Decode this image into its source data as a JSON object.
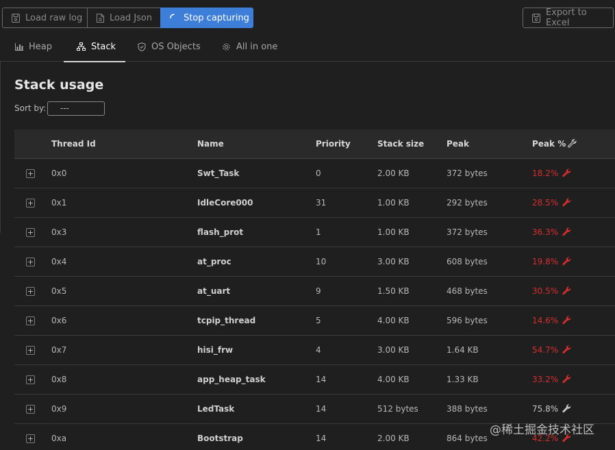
{
  "toolbar": {
    "load_raw_log": "Load raw log",
    "load_json": "Load Json",
    "stop_capturing": "Stop capturing",
    "export_excel": "Export to Excel"
  },
  "tabs": [
    {
      "label": "Heap",
      "icon": "chart-icon"
    },
    {
      "label": "Stack",
      "icon": "hierarchy-icon",
      "active": true
    },
    {
      "label": "OS Objects",
      "icon": "shield-icon"
    },
    {
      "label": "All in one",
      "icon": "gear-icon"
    }
  ],
  "page": {
    "title": "Stack usage",
    "sort_label": "Sort by:",
    "sort_value": "---"
  },
  "table": {
    "columns": [
      "Thread Id",
      "Name",
      "Priority",
      "Stack size",
      "Peak",
      "Peak %"
    ],
    "rows": [
      {
        "id": "0x0",
        "name": "Swt_Task",
        "priority": "0",
        "size": "2.00 KB",
        "peak": "372 bytes",
        "pct": "18.2%",
        "alert": true
      },
      {
        "id": "0x1",
        "name": "IdleCore000",
        "priority": "31",
        "size": "1.00 KB",
        "peak": "292 bytes",
        "pct": "28.5%",
        "alert": true
      },
      {
        "id": "0x3",
        "name": "flash_prot",
        "priority": "1",
        "size": "1.00 KB",
        "peak": "372 bytes",
        "pct": "36.3%",
        "alert": true
      },
      {
        "id": "0x4",
        "name": "at_proc",
        "priority": "10",
        "size": "3.00 KB",
        "peak": "608 bytes",
        "pct": "19.8%",
        "alert": true
      },
      {
        "id": "0x5",
        "name": "at_uart",
        "priority": "9",
        "size": "1.50 KB",
        "peak": "468 bytes",
        "pct": "30.5%",
        "alert": true
      },
      {
        "id": "0x6",
        "name": "tcpip_thread",
        "priority": "5",
        "size": "4.00 KB",
        "peak": "596 bytes",
        "pct": "14.6%",
        "alert": true
      },
      {
        "id": "0x7",
        "name": "hisi_frw",
        "priority": "4",
        "size": "3.00 KB",
        "peak": "1.64 KB",
        "pct": "54.7%",
        "alert": true
      },
      {
        "id": "0x8",
        "name": "app_heap_task",
        "priority": "14",
        "size": "4.00 KB",
        "peak": "1.33 KB",
        "pct": "33.2%",
        "alert": true
      },
      {
        "id": "0x9",
        "name": "LedTask",
        "priority": "14",
        "size": "512 bytes",
        "peak": "388 bytes",
        "pct": "75.8%",
        "alert": false
      },
      {
        "id": "0xa",
        "name": "Bootstrap",
        "priority": "14",
        "size": "2.00 KB",
        "peak": "864 bytes",
        "pct": "42.2%",
        "alert": true
      }
    ]
  },
  "watermark": "@稀土掘金技术社区",
  "colors": {
    "accent": "#3d7fd8",
    "alert": "#d62e2e",
    "background": "#1f1f1f",
    "header": "#2a2a2a"
  }
}
